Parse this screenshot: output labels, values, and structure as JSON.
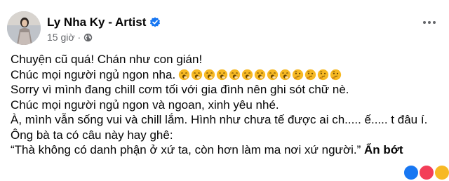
{
  "post": {
    "author": "Ly Nha Ky - Artist",
    "time": "15 giờ",
    "separator": "·",
    "lines": [
      "Chuyện cũ quá! Chán như con gián!",
      "Chúc mọi người ngủ ngon nha.",
      "Sorry vì mình đang chill cơm tối với gia đình nên ghi sót chữ nè.",
      "Chúc mọi người ngủ ngon và ngoan, xinh yêu nhé.",
      "À, mình vẫn sống vui và chill lắm. Hình như chưa tế được ai ch..... ế..... t đâu í.",
      "Ông bà ta có câu này hay ghê:",
      "“Thà không có danh phận ở xứ ta, còn hơn làm ma nơi xứ người.”"
    ],
    "see_more": "Ẩn bớt",
    "emoji_row": [
      "yawning-face",
      "yawning-face",
      "yawning-face",
      "yawning-face",
      "yawning-face",
      "yawning-face",
      "yawning-face",
      "yawning-face",
      "yawning-face",
      "thinking-face",
      "thinking-face",
      "thinking-face",
      "thinking-face"
    ],
    "colors": {
      "verified": "#1877f2",
      "meta": "#65676b",
      "emoji": "#f7b924"
    }
  }
}
